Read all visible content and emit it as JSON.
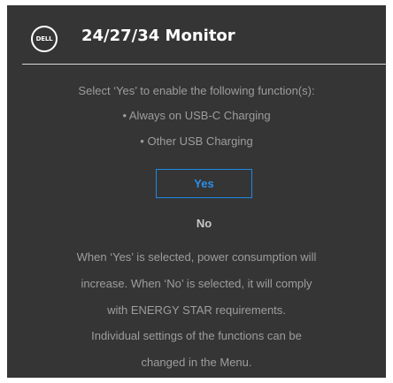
{
  "header": {
    "logo": "DELL",
    "title": "24/27/34 Monitor"
  },
  "prompt": {
    "intro": "Select ‘Yes’ to enable the following function(s):",
    "functions": [
      "•  Always on USB-C Charging",
      "•  Other  USB Charging"
    ]
  },
  "options": {
    "yes_label": "Yes",
    "no_label": "No",
    "selected": "Yes"
  },
  "notes": [
    "When ‘Yes’ is selected, power consumption will",
    "increase. When ‘No’ is selected, it will comply",
    "with ENERGY STAR requirements.",
    "Individual settings of the functions can be",
    "changed in the Menu."
  ],
  "colors": {
    "panel_background": "#353535",
    "accent": "#1e88e5",
    "body_text": "#9d9d9d",
    "title_text": "#ffffff"
  }
}
